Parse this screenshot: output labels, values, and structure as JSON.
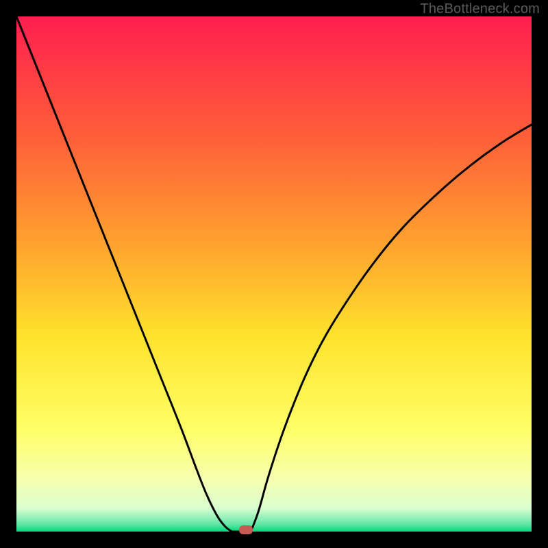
{
  "watermark": "TheBottleneck.com",
  "chart_data": {
    "type": "line",
    "title": "",
    "xlabel": "",
    "ylabel": "",
    "xlim": [
      0,
      100
    ],
    "ylim": [
      0,
      100
    ],
    "grid": false,
    "legend": false,
    "background_gradient_stops": [
      {
        "offset": 0.0,
        "color": "#ff1f4f"
      },
      {
        "offset": 0.22,
        "color": "#ff5a3a"
      },
      {
        "offset": 0.45,
        "color": "#ffa52e"
      },
      {
        "offset": 0.62,
        "color": "#ffe22c"
      },
      {
        "offset": 0.8,
        "color": "#ffff66"
      },
      {
        "offset": 0.9,
        "color": "#f6ffb0"
      },
      {
        "offset": 0.955,
        "color": "#d9ffd0"
      },
      {
        "offset": 0.985,
        "color": "#66e6a8"
      },
      {
        "offset": 1.0,
        "color": "#00d97a"
      }
    ],
    "left_curve": {
      "x": [
        0,
        4,
        8,
        12,
        16,
        20,
        24,
        28,
        32,
        35,
        37,
        39,
        40.5,
        41.8
      ],
      "y": [
        100,
        90,
        80,
        70,
        60,
        50,
        40,
        30,
        20,
        12,
        7,
        3,
        1,
        0
      ]
    },
    "flat_segment": {
      "x": [
        41.8,
        45.5
      ],
      "y": [
        0,
        0
      ]
    },
    "right_curve": {
      "x": [
        45.5,
        47,
        49,
        52,
        56,
        60,
        65,
        70,
        75,
        80,
        85,
        90,
        95,
        100
      ],
      "y": [
        0,
        4,
        11,
        20,
        30,
        38,
        46,
        53,
        59,
        64,
        68.5,
        72.5,
        76,
        79
      ]
    },
    "marker": {
      "x": 44.5,
      "y": 0.3,
      "color": "#c75a52"
    }
  }
}
